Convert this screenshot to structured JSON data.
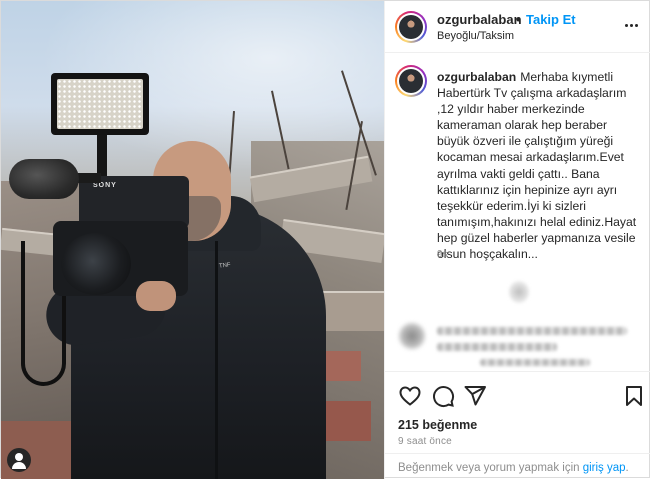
{
  "post": {
    "username": "ozgurbalaban",
    "separator": "•",
    "follow_label": "Takip Et",
    "location": "Beyoğlu/Taksim",
    "more_icon": "more-horizontal-icon",
    "caption": {
      "username": "ozgurbalaban",
      "text": "Merhaba kıymetli Habertürk Tv çalışma arkadaşlarım ,12 yıldır haber merkezinde kameraman olarak hep beraber büyük özveri ile çalıştığım yüreği kocaman mesai arkadaşlarım.Evet ayrılma vakti geldi çattı.. Bana kattıklarınız için hepinize ayrı ayrı teşekkür ederim.İyi ki sizleri tanımışım,hakınızı helal ediniz.Hayat hep güzel haberler yapmanıza vesile olsun hoşçakalın...",
      "time": "9s"
    },
    "likes": "215 beğenme",
    "posted": "9 saat önce",
    "comment_prompt": {
      "text": "Beğenmek veya yorum yapmak için ",
      "link": "giriş yap",
      "end": "."
    }
  },
  "photo": {
    "camera_brand": "SONY",
    "jacket_logo": "THE NORTH FACE"
  },
  "icons": {
    "like": "heart-icon",
    "comment": "comment-icon",
    "share": "send-icon",
    "save": "bookmark-icon",
    "user": "user-icon"
  },
  "colors": {
    "link": "#0095f6",
    "text": "#262626",
    "muted": "#8e8e8e",
    "border": "#efefef"
  }
}
